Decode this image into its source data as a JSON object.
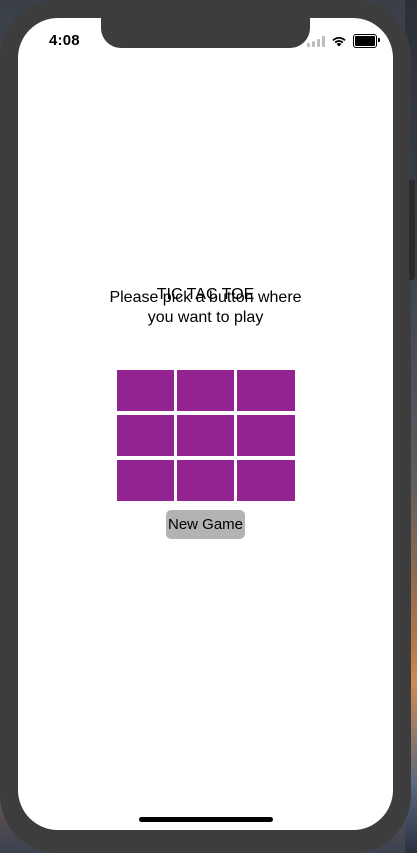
{
  "status_bar": {
    "time": "4:08",
    "icons": [
      "signal-icon",
      "wifi-icon",
      "battery-icon"
    ]
  },
  "game": {
    "title": "TIC TAC TOE",
    "instructions": "Please pick a button where you want to play",
    "cells": [
      "",
      "",
      "",
      "",
      "",
      "",
      "",
      "",
      ""
    ],
    "new_game_label": "New Game"
  },
  "colors": {
    "cell": "#922391",
    "button": "#b3b3b3",
    "device_frame": "#3d3d3d"
  }
}
